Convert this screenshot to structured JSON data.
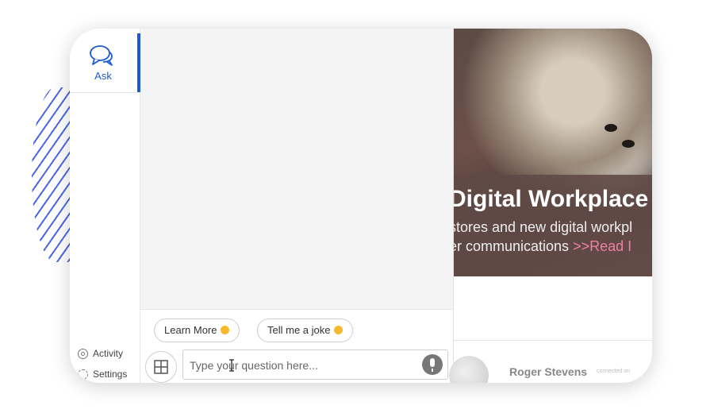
{
  "sidebar": {
    "ask_label": "Ask",
    "activity_label": "Activity",
    "settings_label": "Settings"
  },
  "chat": {
    "suggestions": [
      {
        "label": "Learn More",
        "emoji": "nerd-face"
      },
      {
        "label": "Tell me a joke",
        "emoji": "winking-face"
      }
    ],
    "input_placeholder": "Type your question here..."
  },
  "news": {
    "headline": "Digital Workplace",
    "line1": "stores and new digital workpl",
    "line2_text": "er communications ",
    "line2_link": ">>Read I",
    "author": "Roger Stevens",
    "author_meta": "connected on"
  },
  "colors": {
    "accent": "#1e5bd1",
    "stripes": "#4a66e6",
    "link": "#f07fa3"
  }
}
